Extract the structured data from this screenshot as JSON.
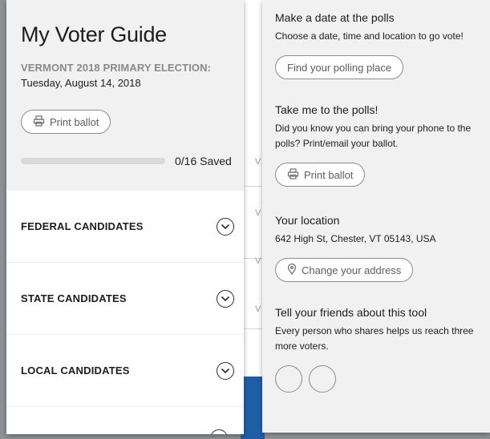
{
  "guide": {
    "title": "My Voter Guide",
    "election_name": "VERMONT 2018 PRIMARY ELECTION:",
    "election_date": "Tuesday, August 14, 2018",
    "print_label": "Print ballot",
    "saved_label": "0/16 Saved",
    "saved_fraction": 0
  },
  "sections": [
    {
      "label": "FEDERAL CANDIDATES"
    },
    {
      "label": "STATE CANDIDATES"
    },
    {
      "label": "LOCAL CANDIDATES"
    }
  ],
  "polls_date": {
    "heading": "Make a date at the polls",
    "text": "Choose a date, time and location to go vote!",
    "button": "Find your polling place"
  },
  "polls_take": {
    "heading": "Take me to the polls!",
    "text": "Did you know you can bring your phone to the polls? Print/email your ballot.",
    "button": "Print ballot"
  },
  "location": {
    "heading": "Your location",
    "address": "642 High St, Chester, VT 05143, USA",
    "button": "Change your address"
  },
  "share": {
    "heading": "Tell your friends about this tool",
    "text": "Every person who shares helps us reach three more voters."
  },
  "colors": {
    "accent": "#1f5fa6",
    "panel_bg": "#f1f1f1",
    "pill_border": "#8c8c8c"
  },
  "icons": {
    "print": "printer-icon",
    "location": "map-pin-icon",
    "expand": "chevron-down-icon"
  }
}
